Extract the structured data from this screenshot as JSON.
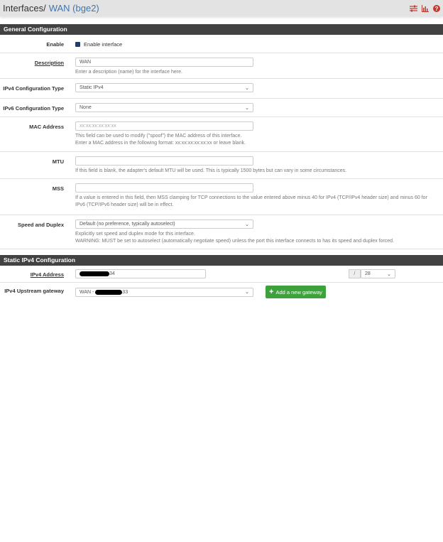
{
  "header": {
    "crumb_root": "Interfaces",
    "crumb_sep": "/",
    "crumb_current": "WAN (bge2)",
    "colors": {
      "icons": "#c0392b",
      "link": "#3c77b0"
    },
    "icons": [
      "sliders-icon",
      "chart-icon",
      "help-icon"
    ]
  },
  "general": {
    "title": "General Configuration",
    "enable": {
      "label": "Enable",
      "checkbox_label": "Enable interface",
      "checked": true
    },
    "description": {
      "label": "Description",
      "value": "WAN",
      "help": "Enter a description (name) for the interface here."
    },
    "ipv4_type": {
      "label": "IPv4 Configuration Type",
      "value": "Static IPv4"
    },
    "ipv6_type": {
      "label": "IPv6 Configuration Type",
      "value": "None"
    },
    "mac": {
      "label": "MAC Address",
      "placeholder": "xx:xx:xx:xx:xx:xx",
      "help1": "This field can be used to modify (\"spoof\") the MAC address of this interface.",
      "help2": "Enter a MAC address in the following format: xx:xx:xx:xx:xx:xx or leave blank."
    },
    "mtu": {
      "label": "MTU",
      "value": "",
      "help": "If this field is blank, the adapter's default MTU will be used. This is typically 1500 bytes but can vary in some circumstances."
    },
    "mss": {
      "label": "MSS",
      "value": "",
      "help": "If a value is entered in this field, then MSS clamping for TCP connections to the value entered above minus 40 for IPv4 (TCP/IPv4 header size) and minus 60 for IPv6 (TCP/IPv6 header size) will be in effect."
    },
    "speed": {
      "label": "Speed and Duplex",
      "value": "Default (no preference, typically autoselect)",
      "help1": "Explicitly set speed and duplex mode for this interface.",
      "help2": "WARNING: MUST be set to autoselect (automatically negotiate speed) unless the port this interface connects to has its speed and duplex forced."
    }
  },
  "static": {
    "title": "Static IPv4 Configuration",
    "address": {
      "label": "IPv4 Address",
      "value_suffix": "34",
      "slash": "/",
      "cidr": "28"
    },
    "gateway": {
      "label": "IPv4 Upstream gateway",
      "value_prefix": "WAN - ",
      "value_suffix": "33",
      "add_button": "Add a new gateway"
    }
  }
}
